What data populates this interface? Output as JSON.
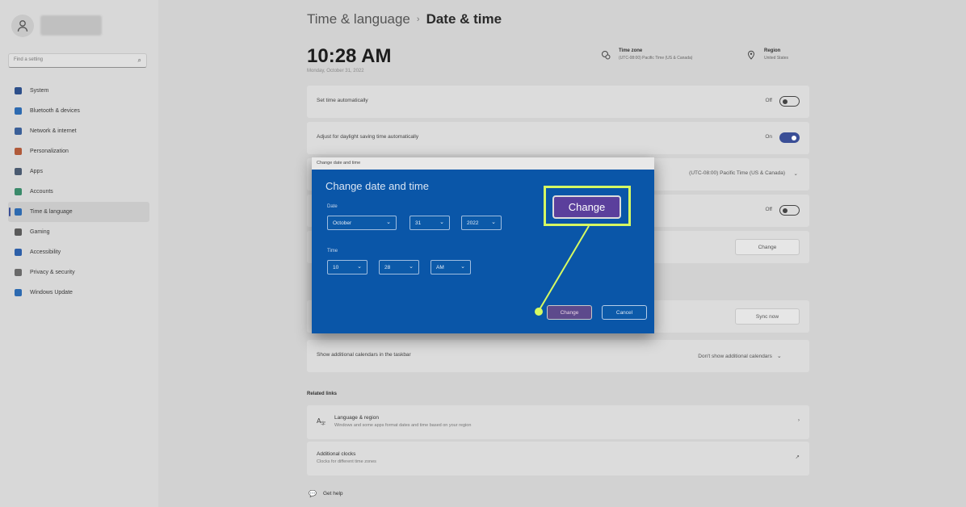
{
  "sidebar": {
    "search_placeholder": "Find a setting",
    "items": [
      {
        "label": "System",
        "icon": "monitor-icon",
        "color": "#2d4f8a"
      },
      {
        "label": "Bluetooth & devices",
        "icon": "bluetooth-icon",
        "color": "#2d6ab0"
      },
      {
        "label": "Network & internet",
        "icon": "wifi-icon",
        "color": "#3a5f98"
      },
      {
        "label": "Personalization",
        "icon": "brush-icon",
        "color": "#b05a3a"
      },
      {
        "label": "Apps",
        "icon": "apps-icon",
        "color": "#4a5a70"
      },
      {
        "label": "Accounts",
        "icon": "person-icon",
        "color": "#3a8a6a"
      },
      {
        "label": "Time & language",
        "icon": "globe-clock-icon",
        "color": "#2d6ab0"
      },
      {
        "label": "Gaming",
        "icon": "gamepad-icon",
        "color": "#5a5a5a"
      },
      {
        "label": "Accessibility",
        "icon": "accessibility-icon",
        "color": "#2d5fa8"
      },
      {
        "label": "Privacy & security",
        "icon": "shield-icon",
        "color": "#6a6a6a"
      },
      {
        "label": "Windows Update",
        "icon": "update-icon",
        "color": "#2d6ab0"
      }
    ],
    "active_index": 6
  },
  "header": {
    "breadcrumb_parent": "Time & language",
    "breadcrumb_current": "Date & time",
    "time": "10:28 AM",
    "date": "Monday, October 31, 2022",
    "timezone_title": "Time zone",
    "timezone_value": "(UTC-08:00) Pacific Time (US & Canada)",
    "region_title": "Region",
    "region_value": "United States"
  },
  "settings": {
    "set_time_auto": {
      "label": "Set time automatically",
      "state": "Off"
    },
    "dst_auto": {
      "label": "Adjust for daylight saving time automatically",
      "state": "On"
    },
    "timezone_dropdown": "(UTC-08:00) Pacific Time (US & Canada)",
    "set_tz_auto_state": "Off",
    "manual_button": "Change",
    "sync_button": "Sync now",
    "calendars_label": "Show additional calendars in the taskbar",
    "calendars_value": "Don't show additional calendars"
  },
  "related": {
    "title": "Related links",
    "lang_region_title": "Language & region",
    "lang_region_sub": "Windows and some apps format dates and time based on your region",
    "add_clocks_title": "Additional clocks",
    "add_clocks_sub": "Clocks for different time zones",
    "get_help": "Get help"
  },
  "dialog": {
    "titlebar": "Change date and time",
    "heading": "Change date and time",
    "date_label": "Date",
    "month": "October",
    "day": "31",
    "year": "2022",
    "time_label": "Time",
    "hour": "10",
    "minute": "28",
    "ampm": "AM",
    "change_label": "Change",
    "cancel_label": "Cancel"
  },
  "callout": {
    "label": "Change",
    "highlight_color": "#d6fa62"
  }
}
